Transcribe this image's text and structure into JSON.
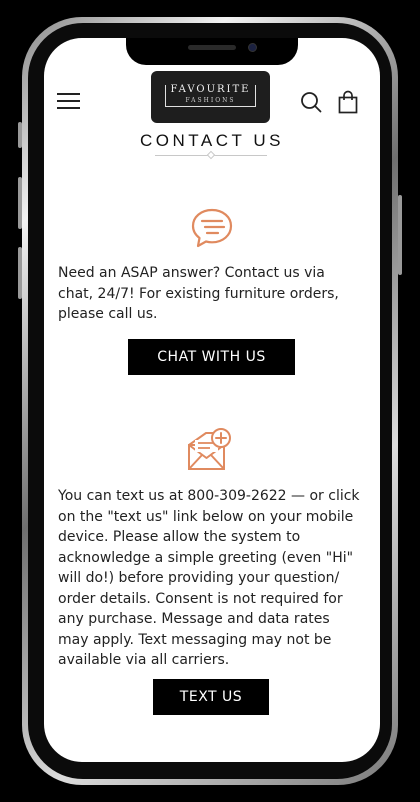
{
  "header": {
    "logo_line1": "FAVOURITE",
    "logo_line2": "FASHIONS",
    "icons": [
      "menu-icon",
      "search-icon",
      "shopping-bag-icon"
    ]
  },
  "page": {
    "title": "CONTACT US"
  },
  "chat": {
    "icon": "chat-bubble-icon",
    "text": "Need an ASAP answer? Contact us via chat, 24/7! For existing furniture orders, please call us.",
    "button_label": "CHAT WITH US"
  },
  "text_msg": {
    "icon": "envelope-plus-icon",
    "text": "You can text us at 800-309-2622 — or click on the \"text us\" link below on your mobile device. Please allow the system to acknowledge a simple greeting (even \"Hi\" will do!) before providing your question/ order details. Consent is not required for any purchase. Message and data rates may apply. Text messaging may not be available via all carriers.",
    "button_label": "TEXT US"
  },
  "colors": {
    "accent": "#e08a5f",
    "button_bg": "#000000",
    "button_text": "#ffffff",
    "logo_bg": "#1e1e1e"
  }
}
